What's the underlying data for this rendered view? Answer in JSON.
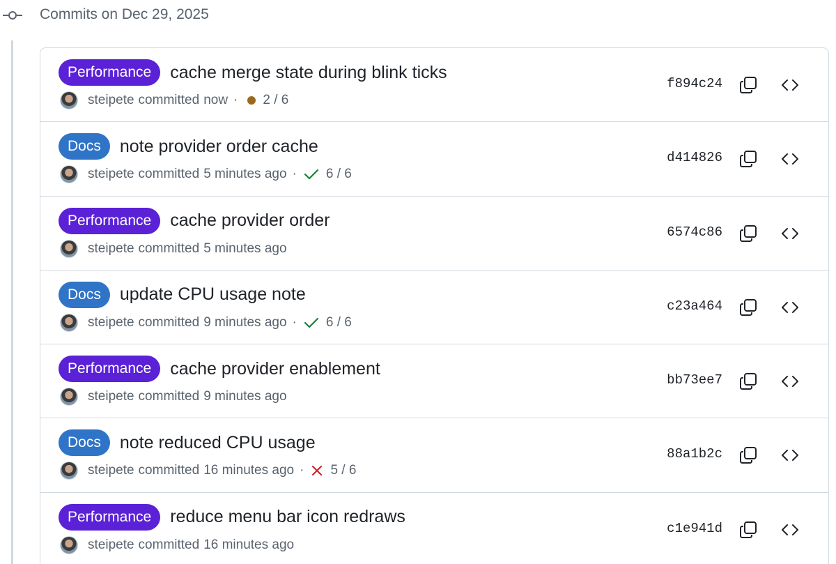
{
  "group": {
    "title": "Commits on Dec 29, 2025",
    "icon": "git-commit-icon"
  },
  "colors": {
    "performance_label": "#5b21d6",
    "docs_label": "#2f74c7",
    "pending": "#9a6a1c",
    "success": "#1a7f37",
    "failure": "#d1242f",
    "muted_text": "#59636e",
    "border": "#d1d9e0"
  },
  "commits": [
    {
      "label": "Performance",
      "label_type": "performance",
      "title": "cache merge state during blink ticks",
      "author": "steipete",
      "action": "committed",
      "time": "now",
      "status": "pending",
      "checks": "2 / 6",
      "sha": "f894c24"
    },
    {
      "label": "Docs",
      "label_type": "docs",
      "title": "note provider order cache",
      "author": "steipete",
      "action": "committed",
      "time": "5 minutes ago",
      "status": "success",
      "checks": "6 / 6",
      "sha": "d414826"
    },
    {
      "label": "Performance",
      "label_type": "performance",
      "title": "cache provider order",
      "author": "steipete",
      "action": "committed",
      "time": "5 minutes ago",
      "status": "none",
      "checks": "",
      "sha": "6574c86"
    },
    {
      "label": "Docs",
      "label_type": "docs",
      "title": "update CPU usage note",
      "author": "steipete",
      "action": "committed",
      "time": "9 minutes ago",
      "status": "success",
      "checks": "6 / 6",
      "sha": "c23a464"
    },
    {
      "label": "Performance",
      "label_type": "performance",
      "title": "cache provider enablement",
      "author": "steipete",
      "action": "committed",
      "time": "9 minutes ago",
      "status": "none",
      "checks": "",
      "sha": "bb73ee7"
    },
    {
      "label": "Docs",
      "label_type": "docs",
      "title": "note reduced CPU usage",
      "author": "steipete",
      "action": "committed",
      "time": "16 minutes ago",
      "status": "failure",
      "checks": "5 / 6",
      "sha": "88a1b2c"
    },
    {
      "label": "Performance",
      "label_type": "performance",
      "title": "reduce menu bar icon redraws",
      "author": "steipete",
      "action": "committed",
      "time": "16 minutes ago",
      "status": "none",
      "checks": "",
      "sha": "c1e941d"
    }
  ]
}
